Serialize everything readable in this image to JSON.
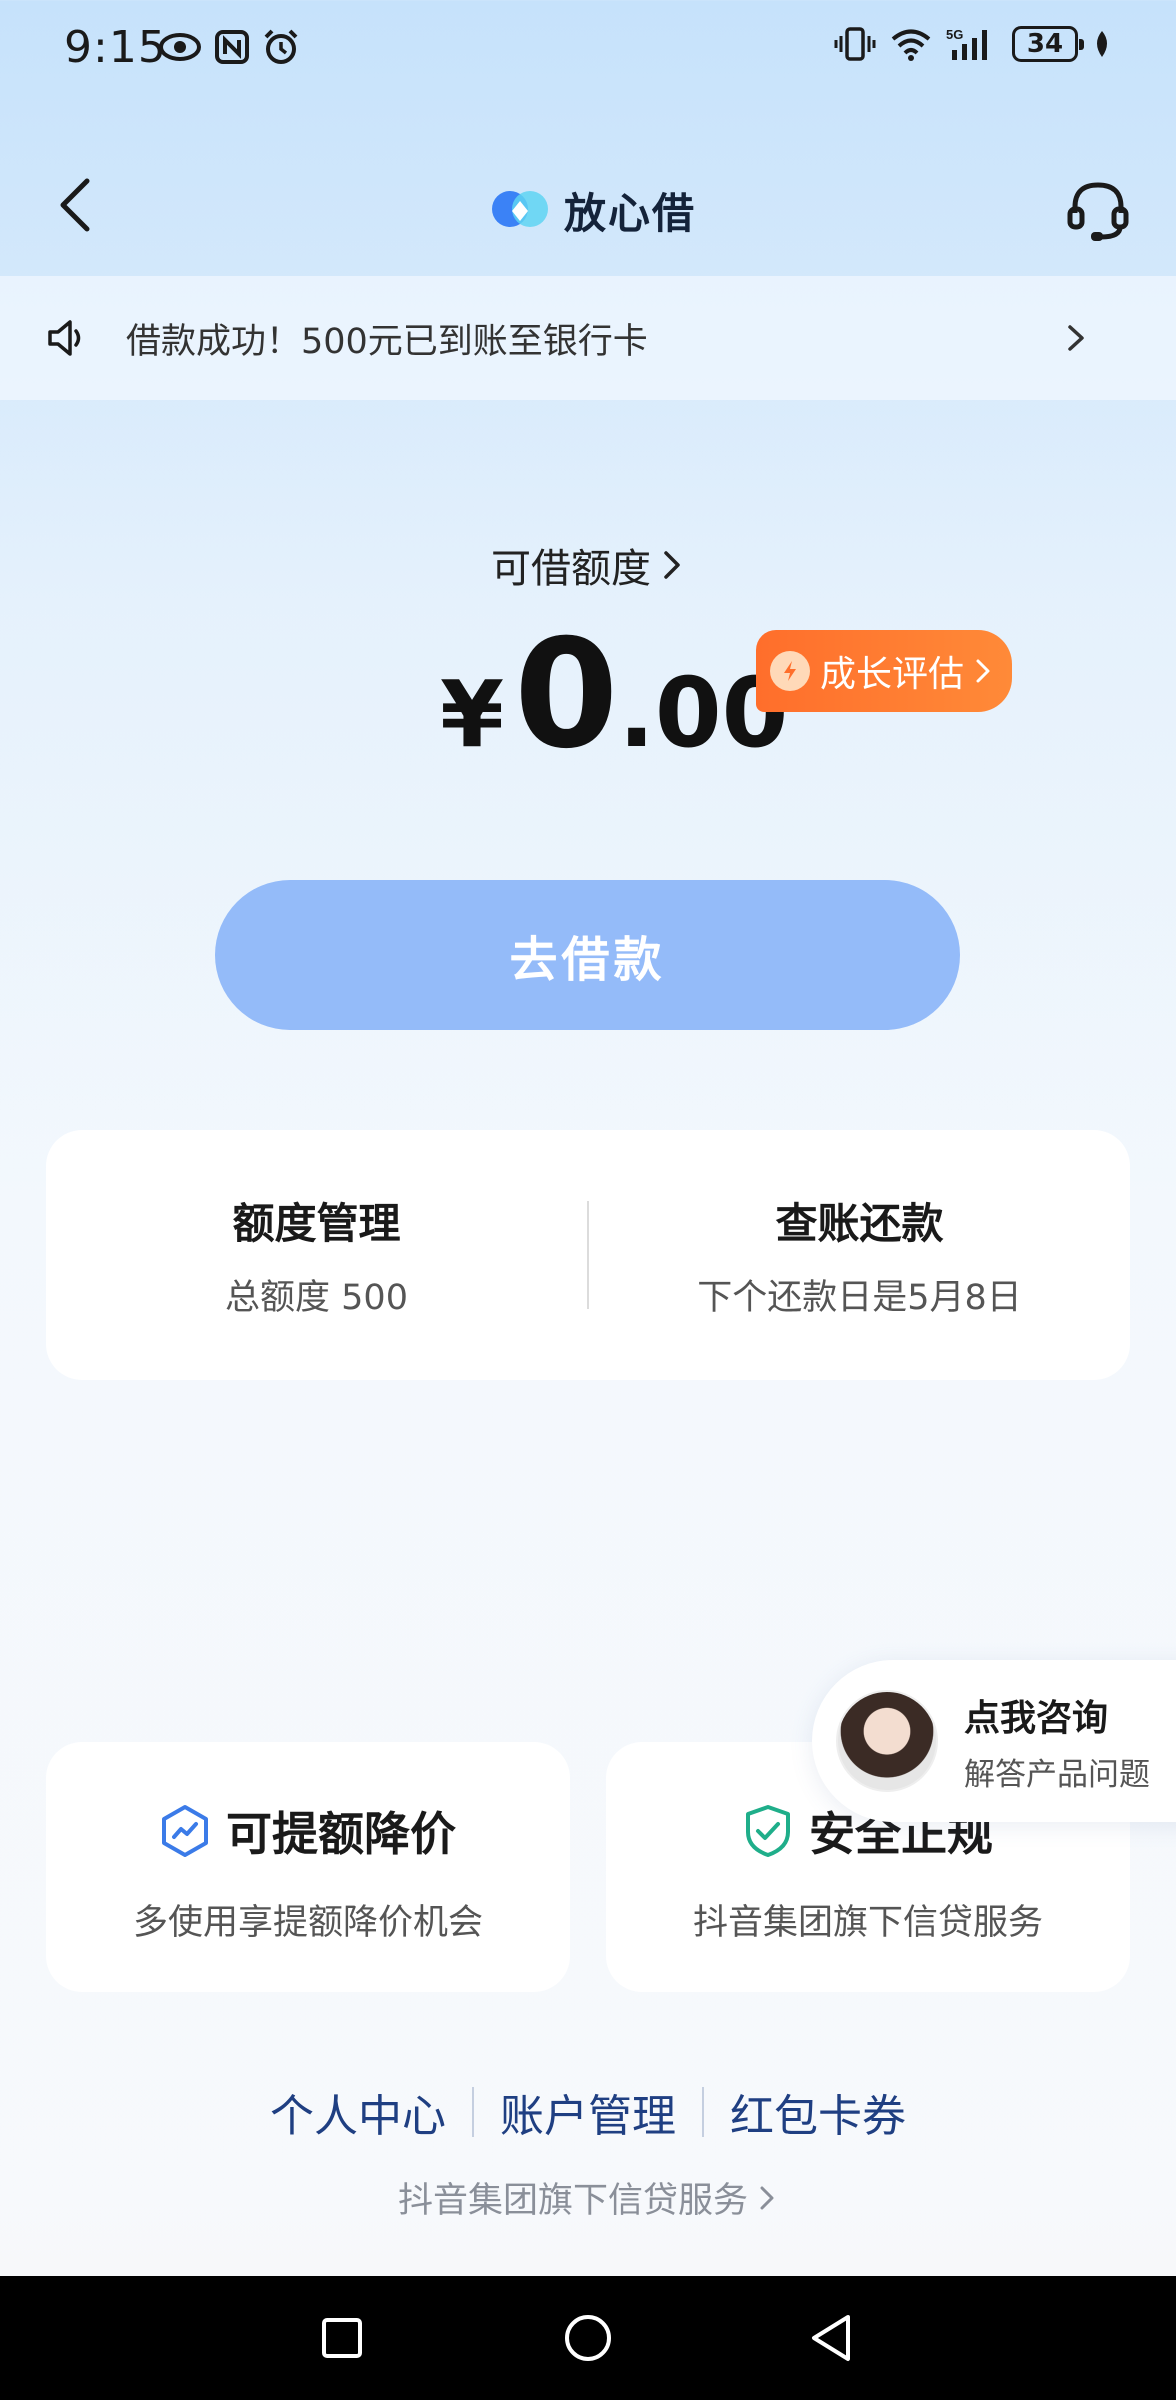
{
  "status_bar": {
    "time": "9:15",
    "battery": "34",
    "icons": [
      "eye-icon",
      "nfc-icon",
      "alarm-icon",
      "vibrate-icon",
      "wifi-icon",
      "signal-5g-icon",
      "battery-icon",
      "leaf-icon"
    ]
  },
  "header": {
    "title": "放心借",
    "back_icon": "back-arrow-icon",
    "service_icon": "headset-icon"
  },
  "notice": {
    "text": "借款成功！500元已到账至银行卡"
  },
  "balance": {
    "label": "可借额度",
    "currency": "¥",
    "integer": "0",
    "decimal": ".00",
    "badge_label": "成长评估"
  },
  "borrow_button": {
    "label": "去借款"
  },
  "info_card": {
    "quota_title": "额度管理",
    "quota_sub": "总额度 500",
    "repay_title": "查账还款",
    "repay_sub": "下个还款日是5月8日"
  },
  "features": [
    {
      "title": "可提额降价",
      "sub": "多使用享提额降价机会"
    },
    {
      "title": "安全正规",
      "sub": "抖音集团旗下信贷服务"
    }
  ],
  "consult": {
    "title": "点我咨询",
    "sub": "解答产品问题"
  },
  "footer": {
    "links": [
      "个人中心",
      "账户管理",
      "红包卡券"
    ],
    "note": "抖音集团旗下信贷服务"
  },
  "colors": {
    "primary_button": "#94bbf9",
    "badge": "#ff7630",
    "link": "#1f3f82"
  }
}
